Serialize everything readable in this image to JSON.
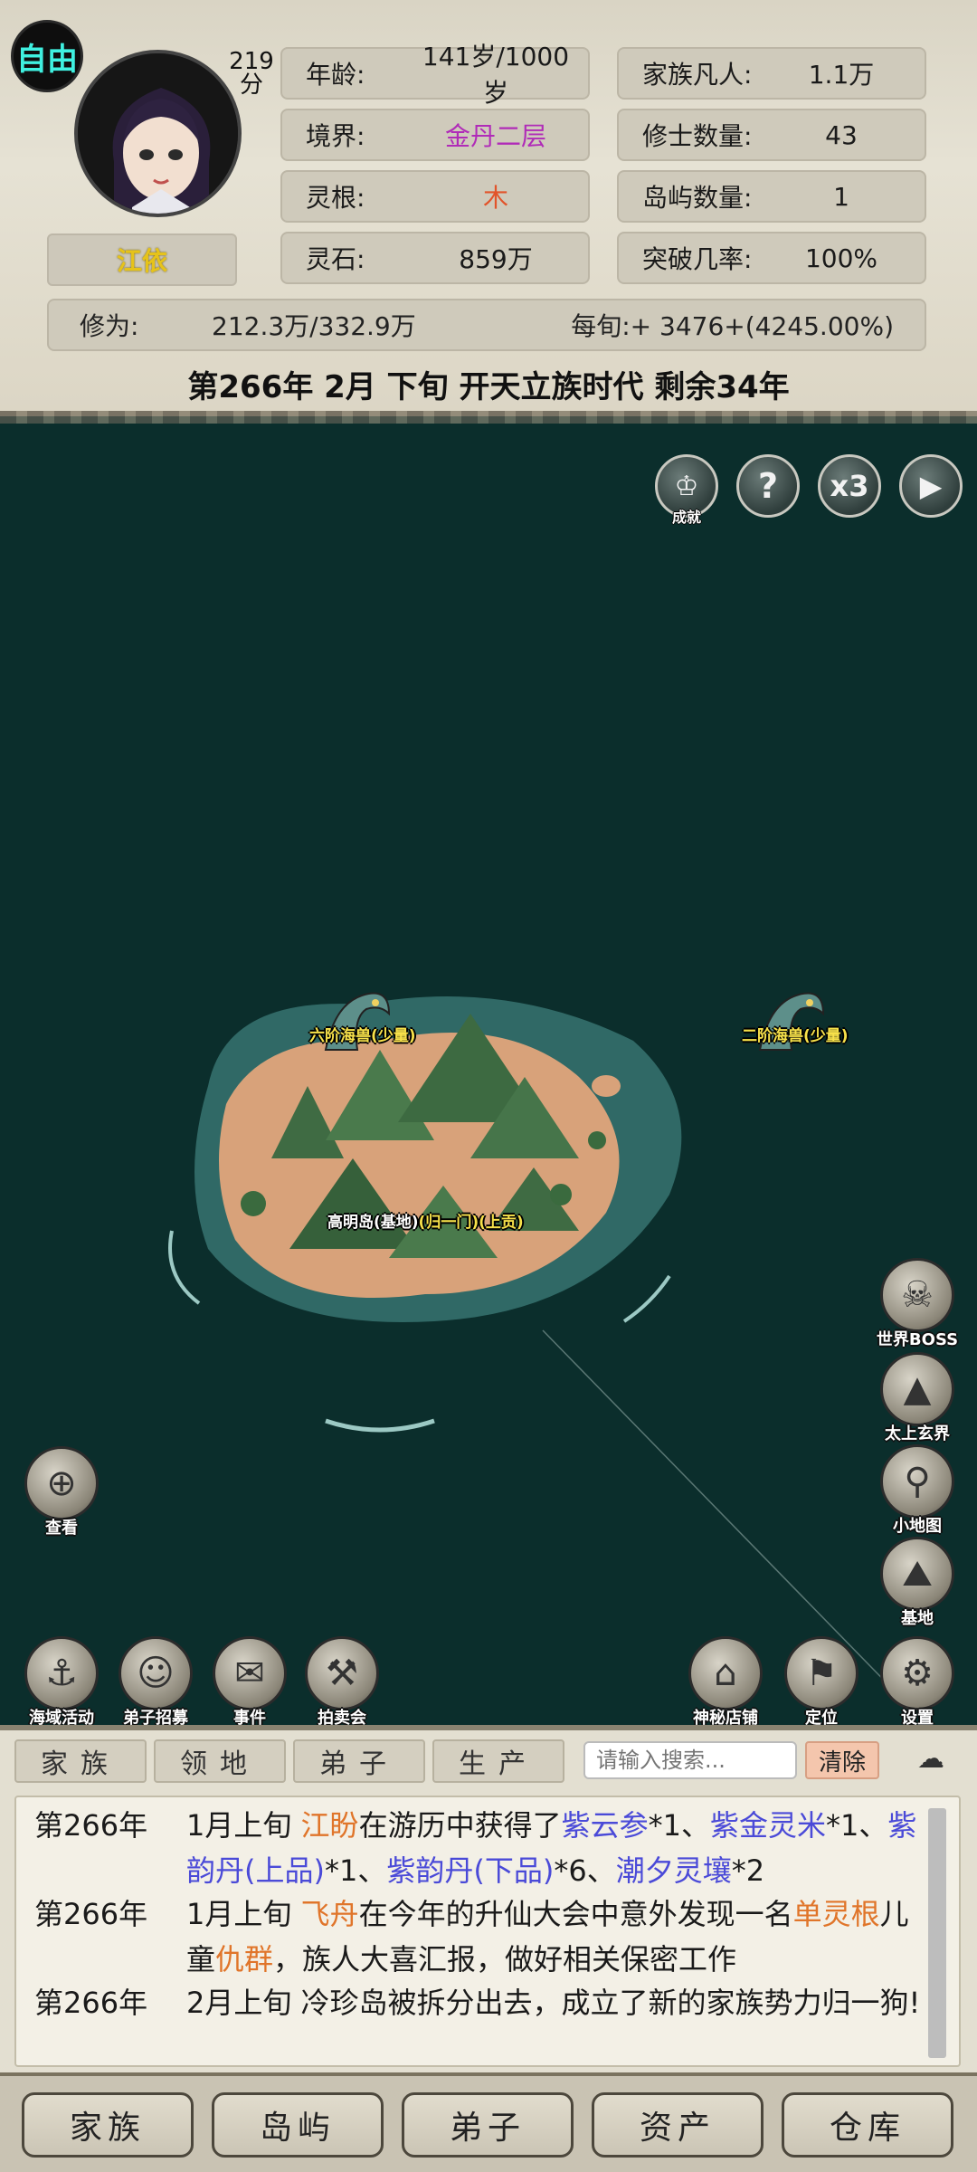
{
  "header": {
    "mode_badge": "自由",
    "score_value": "219",
    "score_unit": "分",
    "character_name": "江依",
    "stats_left": [
      {
        "key": "年龄:",
        "value": "141岁/1000岁"
      },
      {
        "key": "境界:",
        "value": "金丹二层"
      },
      {
        "key": "灵根:",
        "value": "木"
      },
      {
        "key": "灵石:",
        "value": "859万"
      }
    ],
    "stats_right": [
      {
        "key": "家族凡人:",
        "value": "1.1万"
      },
      {
        "key": "修士数量:",
        "value": "43"
      },
      {
        "key": "岛屿数量:",
        "value": "1"
      },
      {
        "key": "突破几率:",
        "value": "100%"
      }
    ],
    "cultivation_key": "修为:",
    "cultivation_value": "212.3万/332.9万",
    "per_period": "每旬:+ 3476+(4245.00%)",
    "date_line": "第266年 2月 下旬  开天立族时代 剩余34年"
  },
  "colors": {
    "realm": "#b02bb8",
    "root": "#e2542a",
    "name": "#e6c31a",
    "ocean": "#0b2e2c"
  },
  "map": {
    "top_controls": [
      {
        "name": "achievement",
        "label": "成就",
        "icon": "trophy-icon"
      },
      {
        "name": "help",
        "label": "?",
        "icon": "question-icon"
      },
      {
        "name": "speed",
        "label": "x3",
        "icon": "speed-icon"
      },
      {
        "name": "play",
        "label": "▶",
        "icon": "play-icon"
      }
    ],
    "monsters": [
      {
        "label": "六阶海兽(少量)"
      },
      {
        "label": "二阶海兽(少量)"
      }
    ],
    "island": {
      "name": "高明岛(基地)",
      "sect": "(归一门)(上贡)"
    },
    "right_buttons": [
      {
        "label": "世界BOSS",
        "icon": "demon-icon"
      },
      {
        "label": "太上玄界",
        "icon": "mountain-icon"
      },
      {
        "label": "小地图",
        "icon": "map-pin-icon"
      },
      {
        "label": "基地",
        "icon": "peak-icon"
      }
    ],
    "view_button": {
      "label": "查看",
      "icon": "crosshair-icon"
    },
    "bottom_left_buttons": [
      {
        "label": "海域活动",
        "icon": "anchor-icon"
      },
      {
        "label": "弟子招募",
        "icon": "disciple-icon"
      },
      {
        "label": "事件",
        "icon": "scroll-icon"
      },
      {
        "label": "拍卖会",
        "icon": "gavel-icon"
      }
    ],
    "bottom_right_buttons": [
      {
        "label": "神秘店铺",
        "icon": "shop-icon"
      },
      {
        "label": "定位",
        "icon": "flag-icon"
      },
      {
        "label": "设置",
        "icon": "gear-icon"
      }
    ]
  },
  "log": {
    "tabs": [
      "家族",
      "领地",
      "弟子",
      "生产"
    ],
    "search_placeholder": "请输入搜索...",
    "clear_label": "清除",
    "entries": [
      {
        "year": "第266年",
        "parts": [
          {
            "t": "1月上旬 ",
            "c": ""
          },
          {
            "t": "江盼",
            "c": "o"
          },
          {
            "t": "在游历中获得了",
            "c": ""
          },
          {
            "t": "紫云参",
            "c": "p"
          },
          {
            "t": "*1、",
            "c": ""
          },
          {
            "t": "紫金灵米",
            "c": "p"
          },
          {
            "t": "*1、",
            "c": ""
          },
          {
            "t": "紫韵丹(上品)",
            "c": "p"
          },
          {
            "t": "*1、",
            "c": ""
          },
          {
            "t": "紫韵丹(下品)",
            "c": "p"
          },
          {
            "t": "*6、",
            "c": ""
          },
          {
            "t": "潮夕灵壤",
            "c": "p"
          },
          {
            "t": "*2",
            "c": ""
          }
        ]
      },
      {
        "year": "第266年",
        "parts": [
          {
            "t": "1月上旬 ",
            "c": ""
          },
          {
            "t": "飞舟",
            "c": "o"
          },
          {
            "t": "在今年的升仙大会中意外发现一名",
            "c": ""
          },
          {
            "t": "单灵根",
            "c": "o"
          },
          {
            "t": "儿童",
            "c": ""
          },
          {
            "t": "仇群",
            "c": "o"
          },
          {
            "t": "，族人大喜汇报，做好相关保密工作",
            "c": ""
          }
        ]
      },
      {
        "year": "第266年",
        "parts": [
          {
            "t": "2月上旬 冷珍岛被拆分出去，成立了新的家族势力归一狗!",
            "c": ""
          }
        ]
      }
    ]
  },
  "bottom_nav": [
    "家族",
    "岛屿",
    "弟子",
    "资产",
    "仓库"
  ]
}
